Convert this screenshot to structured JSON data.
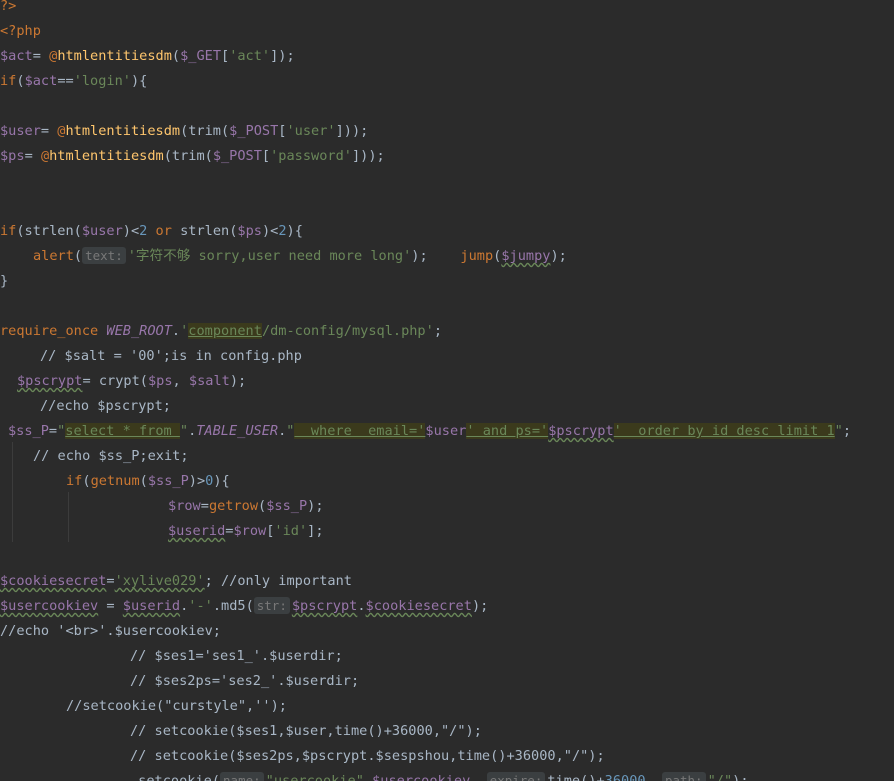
{
  "lines": [
    {
      "indent": 0,
      "tokens": [
        {
          "t": "?>",
          "c": "tag"
        }
      ]
    },
    {
      "indent": 0,
      "tokens": [
        {
          "t": "<?php",
          "c": "tag"
        }
      ]
    },
    {
      "indent": 0,
      "tokens": [
        {
          "t": "$act",
          "c": "var"
        },
        {
          "t": "= ",
          "c": "plain"
        },
        {
          "t": "@",
          "c": "kw"
        },
        {
          "t": "htmlentitiesdm",
          "c": "fn"
        },
        {
          "t": "(",
          "c": "plain"
        },
        {
          "t": "$_GET",
          "c": "var"
        },
        {
          "t": "[",
          "c": "plain"
        },
        {
          "t": "'act'",
          "c": "str"
        },
        {
          "t": "]);",
          "c": "plain"
        }
      ]
    },
    {
      "indent": 0,
      "tokens": [
        {
          "t": "if",
          "c": "kw"
        },
        {
          "t": "(",
          "c": "plain"
        },
        {
          "t": "$act",
          "c": "var"
        },
        {
          "t": "==",
          "c": "plain"
        },
        {
          "t": "'login'",
          "c": "str"
        },
        {
          "t": "){",
          "c": "plain"
        }
      ]
    },
    {
      "indent": 0,
      "tokens": []
    },
    {
      "indent": 0,
      "tokens": [
        {
          "t": "$user",
          "c": "var"
        },
        {
          "t": "= ",
          "c": "plain"
        },
        {
          "t": "@",
          "c": "kw"
        },
        {
          "t": "htmlentitiesdm",
          "c": "fn"
        },
        {
          "t": "(trim(",
          "c": "plain"
        },
        {
          "t": "$_POST",
          "c": "var"
        },
        {
          "t": "[",
          "c": "plain"
        },
        {
          "t": "'user'",
          "c": "str"
        },
        {
          "t": "]));",
          "c": "plain"
        }
      ]
    },
    {
      "indent": 0,
      "tokens": [
        {
          "t": "$ps",
          "c": "var"
        },
        {
          "t": "= ",
          "c": "plain"
        },
        {
          "t": "@",
          "c": "kw"
        },
        {
          "t": "htmlentitiesdm",
          "c": "fn"
        },
        {
          "t": "(trim(",
          "c": "plain"
        },
        {
          "t": "$_POST",
          "c": "var"
        },
        {
          "t": "[",
          "c": "plain"
        },
        {
          "t": "'password'",
          "c": "str"
        },
        {
          "t": "]));",
          "c": "plain"
        }
      ]
    },
    {
      "indent": 0,
      "tokens": []
    },
    {
      "indent": 0,
      "tokens": []
    },
    {
      "indent": 0,
      "tokens": [
        {
          "t": "if",
          "c": "kw"
        },
        {
          "t": "(strlen(",
          "c": "plain"
        },
        {
          "t": "$user",
          "c": "var"
        },
        {
          "t": ")<",
          "c": "plain"
        },
        {
          "t": "2",
          "c": "num"
        },
        {
          "t": " or ",
          "c": "kw"
        },
        {
          "t": "strlen(",
          "c": "plain"
        },
        {
          "t": "$ps",
          "c": "var"
        },
        {
          "t": ")<",
          "c": "plain"
        },
        {
          "t": "2",
          "c": "num"
        },
        {
          "t": "){",
          "c": "plain"
        }
      ]
    },
    {
      "indent": 33,
      "tokens": [
        {
          "t": "alert",
          "c": "kw"
        },
        {
          "t": "(",
          "c": "plain"
        },
        {
          "t": "text:",
          "c": "hint"
        },
        {
          "t": "'字符不够 sorry,user need more long'",
          "c": "str"
        },
        {
          "t": ");    ",
          "c": "plain"
        },
        {
          "t": "jump",
          "c": "kw"
        },
        {
          "t": "(",
          "c": "plain"
        },
        {
          "t": "$jumpy",
          "c": "var squig"
        },
        {
          "t": ");",
          "c": "plain"
        }
      ]
    },
    {
      "indent": 0,
      "tokens": [
        {
          "t": "}",
          "c": "plain"
        }
      ]
    },
    {
      "indent": 0,
      "tokens": []
    },
    {
      "indent": 0,
      "tokens": [
        {
          "t": "require_once ",
          "c": "kw"
        },
        {
          "t": "WEB_ROOT",
          "c": "const"
        },
        {
          "t": ".",
          "c": "plain"
        },
        {
          "t": "'",
          "c": "str"
        },
        {
          "t": "component",
          "c": "sqlstr"
        },
        {
          "t": "/dm-config/mysql.php'",
          "c": "str"
        },
        {
          "t": ";",
          "c": "plain"
        }
      ]
    },
    {
      "indent": 40,
      "tokens": [
        {
          "t": "// $salt = '00';is in config.php",
          "c": "com"
        }
      ]
    },
    {
      "indent": 17,
      "tokens": [
        {
          "t": "$pscrypt",
          "c": "var squig"
        },
        {
          "t": "= crypt(",
          "c": "plain"
        },
        {
          "t": "$ps",
          "c": "var"
        },
        {
          "t": ", ",
          "c": "plain"
        },
        {
          "t": "$salt",
          "c": "var"
        },
        {
          "t": ");",
          "c": "plain"
        }
      ]
    },
    {
      "indent": 40,
      "tokens": [
        {
          "t": "//echo $pscrypt;",
          "c": "com"
        }
      ]
    },
    {
      "indent": 8,
      "tokens": [
        {
          "t": "$ss_P",
          "c": "var"
        },
        {
          "t": "=",
          "c": "plain"
        },
        {
          "t": "\"",
          "c": "str"
        },
        {
          "t": "select * from ",
          "c": "sqlstr"
        },
        {
          "t": "\"",
          "c": "str"
        },
        {
          "t": ".",
          "c": "plain"
        },
        {
          "t": "TABLE_USER",
          "c": "const"
        },
        {
          "t": ".",
          "c": "plain"
        },
        {
          "t": "\"",
          "c": "str"
        },
        {
          "t": "  where  email='",
          "c": "sqlstr"
        },
        {
          "t": "$user",
          "c": "var"
        },
        {
          "t": "' and ps='",
          "c": "sqlstr"
        },
        {
          "t": "$pscrypt",
          "c": "var squig"
        },
        {
          "t": "'  order by id desc limit 1",
          "c": "sqlstr"
        },
        {
          "t": "\"",
          "c": "str"
        },
        {
          "t": ";",
          "c": "plain"
        }
      ]
    },
    {
      "indent": 33,
      "tokens": [
        {
          "t": "// echo $ss_P;exit;",
          "c": "com"
        }
      ]
    },
    {
      "indent": 66,
      "tokens": [
        {
          "t": "if",
          "c": "kw"
        },
        {
          "t": "(",
          "c": "plain"
        },
        {
          "t": "getnum",
          "c": "kw"
        },
        {
          "t": "(",
          "c": "plain"
        },
        {
          "t": "$ss_P",
          "c": "var"
        },
        {
          "t": ")>",
          "c": "plain"
        },
        {
          "t": "0",
          "c": "num"
        },
        {
          "t": "){",
          "c": "plain"
        }
      ]
    },
    {
      "indent": 168,
      "tokens": [
        {
          "t": "$row",
          "c": "var"
        },
        {
          "t": "=",
          "c": "plain"
        },
        {
          "t": "getrow",
          "c": "kw"
        },
        {
          "t": "(",
          "c": "plain"
        },
        {
          "t": "$ss_P",
          "c": "var"
        },
        {
          "t": ");",
          "c": "plain"
        }
      ]
    },
    {
      "indent": 168,
      "tokens": [
        {
          "t": "$userid",
          "c": "var squig"
        },
        {
          "t": "=",
          "c": "plain"
        },
        {
          "t": "$row",
          "c": "var"
        },
        {
          "t": "[",
          "c": "plain"
        },
        {
          "t": "'id'",
          "c": "str"
        },
        {
          "t": "];",
          "c": "plain"
        }
      ]
    },
    {
      "indent": 0,
      "tokens": []
    },
    {
      "indent": 0,
      "tokens": [
        {
          "t": "$cookiesecret",
          "c": "var squig"
        },
        {
          "t": "=",
          "c": "plain"
        },
        {
          "t": "'xylive029'",
          "c": "str squig"
        },
        {
          "t": "; ",
          "c": "plain"
        },
        {
          "t": "//only important",
          "c": "com"
        }
      ]
    },
    {
      "indent": 0,
      "tokens": [
        {
          "t": "$usercookiev",
          "c": "var squig"
        },
        {
          "t": " = ",
          "c": "plain"
        },
        {
          "t": "$userid",
          "c": "var squig"
        },
        {
          "t": ".",
          "c": "plain"
        },
        {
          "t": "'-'",
          "c": "str"
        },
        {
          "t": ".md5(",
          "c": "plain"
        },
        {
          "t": "str:",
          "c": "hint"
        },
        {
          "t": "$pscrypt",
          "c": "var squig"
        },
        {
          "t": ".",
          "c": "plain"
        },
        {
          "t": "$cookiesecret",
          "c": "var squig"
        },
        {
          "t": ");",
          "c": "plain"
        }
      ]
    },
    {
      "indent": 0,
      "tokens": [
        {
          "t": "//echo '<br>'.$usercookiev;",
          "c": "com"
        }
      ]
    },
    {
      "indent": 130,
      "tokens": [
        {
          "t": "// $ses1='ses1_'.$userdir;",
          "c": "com"
        }
      ]
    },
    {
      "indent": 130,
      "tokens": [
        {
          "t": "// $ses2ps='ses2_'.$userdir;",
          "c": "com"
        }
      ]
    },
    {
      "indent": 66,
      "tokens": [
        {
          "t": "//setcookie(\"curstyle\",'');",
          "c": "com"
        }
      ]
    },
    {
      "indent": 130,
      "tokens": [
        {
          "t": "// setcookie($ses1,$user,time()+36000,\"/\");",
          "c": "com"
        }
      ]
    },
    {
      "indent": 130,
      "tokens": [
        {
          "t": "// setcookie($ses2ps,$pscrypt.$sespshou,time()+36000,\"/\");",
          "c": "com"
        }
      ]
    },
    {
      "indent": 130,
      "tokens": [
        {
          "t": " setcookie(",
          "c": "plain"
        },
        {
          "t": "name:",
          "c": "hint"
        },
        {
          "t": "\"usercookie\"",
          "c": "str"
        },
        {
          "t": ",",
          "c": "plain"
        },
        {
          "t": "$usercookiev",
          "c": "var"
        },
        {
          "t": ", ",
          "c": "plain"
        },
        {
          "t": "expire:",
          "c": "hint"
        },
        {
          "t": "time()+",
          "c": "plain"
        },
        {
          "t": "36000",
          "c": "num"
        },
        {
          "t": ", ",
          "c": "plain"
        },
        {
          "t": "path:",
          "c": "hint"
        },
        {
          "t": "\"/\"",
          "c": "str"
        },
        {
          "t": ");",
          "c": "plain"
        }
      ]
    }
  ]
}
